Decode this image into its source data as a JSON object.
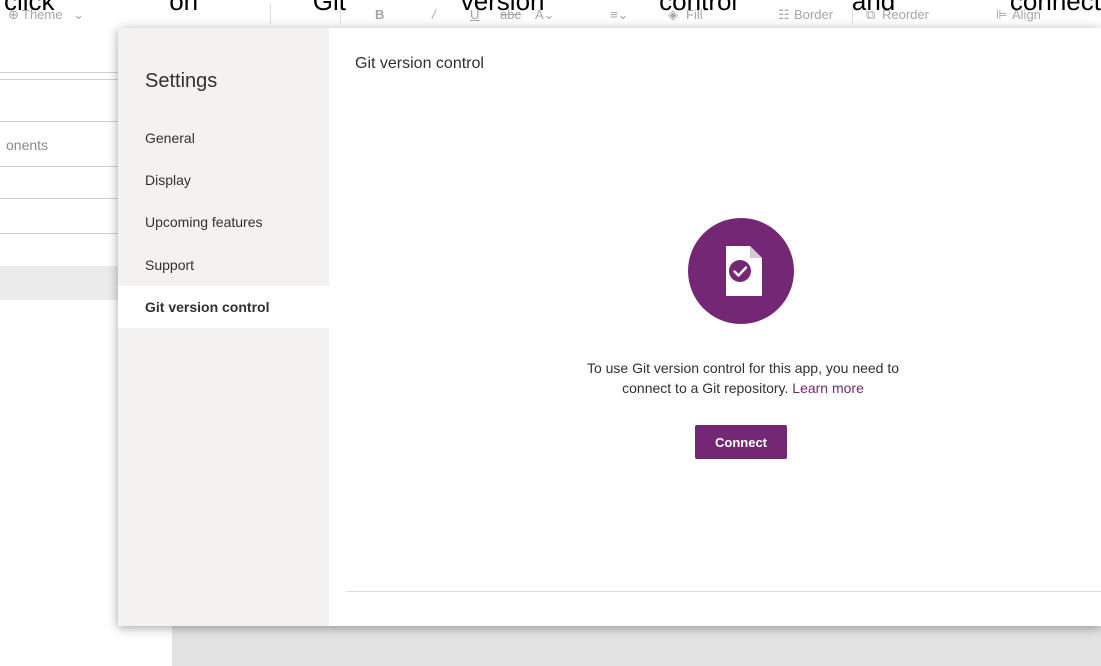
{
  "doc_caption": [
    "click",
    "on",
    "Git",
    "version",
    "control",
    "and",
    "connect"
  ],
  "ribbon": {
    "theme_label": "Theme",
    "fill_label": "Fill",
    "border_label": "Border",
    "reorder_label": "Reorder",
    "align_label": "Align"
  },
  "left_pane": {
    "partial_label": "onents"
  },
  "settings": {
    "title": "Settings",
    "nav_items": [
      {
        "label": "General"
      },
      {
        "label": "Display"
      },
      {
        "label": "Upcoming features"
      },
      {
        "label": "Support"
      },
      {
        "label": "Git version control",
        "active": true
      }
    ]
  },
  "git": {
    "heading": "Git version control",
    "message_line1": "To use Git version control for this app, you need to",
    "message_line2": "connect to a Git repository.",
    "learn_more": "Learn more",
    "connect_label": "Connect"
  },
  "colors": {
    "accent": "#742774",
    "nav_bg": "#f3f2f1",
    "active_bg": "#ffffff"
  }
}
